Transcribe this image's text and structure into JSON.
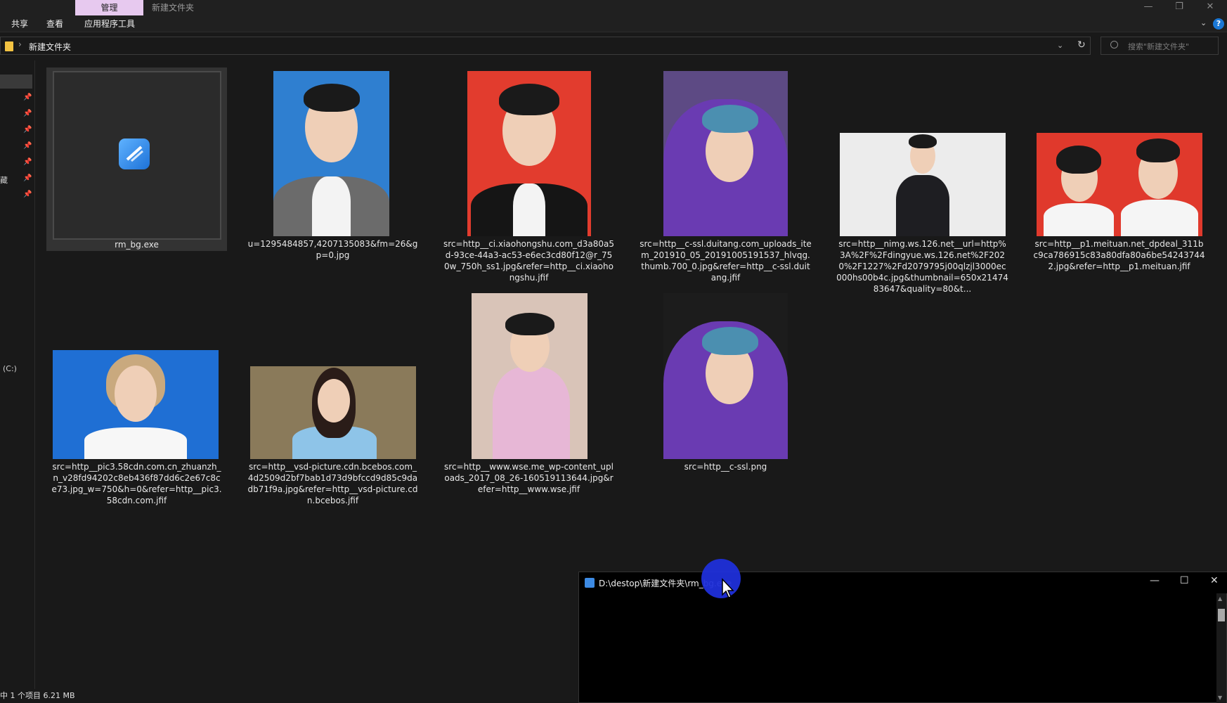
{
  "titlebar": {
    "manage_tab": "管理",
    "title": "新建文件夹",
    "minimize": "—",
    "restore": "❐",
    "close": "✕"
  },
  "ribbon": {
    "tabs": [
      "共享",
      "查看",
      "应用程序工具"
    ],
    "expand_icon": "chevron-down-icon",
    "help": "?"
  },
  "address": {
    "path": "新建文件夹",
    "separator": "›",
    "dropdown": "⌄",
    "refresh": "↻",
    "search_placeholder": "搜索\"新建文件夹\""
  },
  "sidebar": {
    "fragment_fav": "藏",
    "fragment_drive": "(C:)"
  },
  "files": [
    {
      "name": "rm_bg.exe",
      "type": "exe",
      "selected": true
    },
    {
      "name": "u=1295484857,4207135083&fm=26&gp=0.jpg",
      "type": "image",
      "bg": "#2f7fd0"
    },
    {
      "name": "src=http__ci.xiaohongshu.com_d3a80a5d-93ce-44a3-ac53-e6ec3cd80f12@r_750w_750h_ss1.jpg&refer=http__ci.xiaohongshu.jfif",
      "type": "image",
      "bg": "#e23c2e"
    },
    {
      "name": "src=http__c-ssl.duitang.com_uploads_item_201910_05_20191005191537_hlvqg.thumb.700_0.jpg&refer=http__c-ssl.duitang.jfif",
      "type": "image",
      "bg": "#6a3bb2"
    },
    {
      "name": "src=http__nimg.ws.126.net__url=http%3A%2F%2Fdingyue.ws.126.net%2F2020%2F1227%2Fd2079795j00qlzjl3000ec000hs00b4c.jpg&thumbnail=650x2147483647&quality=80&t...",
      "type": "image",
      "bg": "#ececec"
    },
    {
      "name": "src=http__p1.meituan.net_dpdeal_311bc9ca786915c83a80dfa80a6be542437442.jpg&refer=http__p1.meituan.jfif",
      "type": "image",
      "bg": "#e0392c"
    },
    {
      "name": "src=http__pic3.58cdn.com.cn_zhuanzh_n_v28fd94202c8eb436f87dd6c2e67c8ce73.jpg_w=750&h=0&refer=http__pic3.58cdn.com.jfif",
      "type": "image",
      "bg": "#1f6fd4"
    },
    {
      "name": "src=http__vsd-picture.cdn.bcebos.com_4d2509d2bf7bab1d73d9bfccd9d85c9dadb71f9a.jpg&refer=http__vsd-picture.cdn.bcebos.jfif",
      "type": "image",
      "bg": "#8a7a5a"
    },
    {
      "name": "src=http__www.wse.me_wp-content_uploads_2017_08_26-160519113644.jpg&refer=http__www.wse.jfif",
      "type": "image",
      "bg": "#d9c4b8"
    },
    {
      "name": "src=http__c-ssl.png",
      "type": "image",
      "bg": "#6a3bb2"
    }
  ],
  "console": {
    "title": "D:\\destop\\新建文件夹\\rm_bg.exe",
    "minimize": "—",
    "maximize": "☐",
    "close": "✕"
  },
  "status": {
    "text": "中 1 个项目   6.21 MB"
  }
}
